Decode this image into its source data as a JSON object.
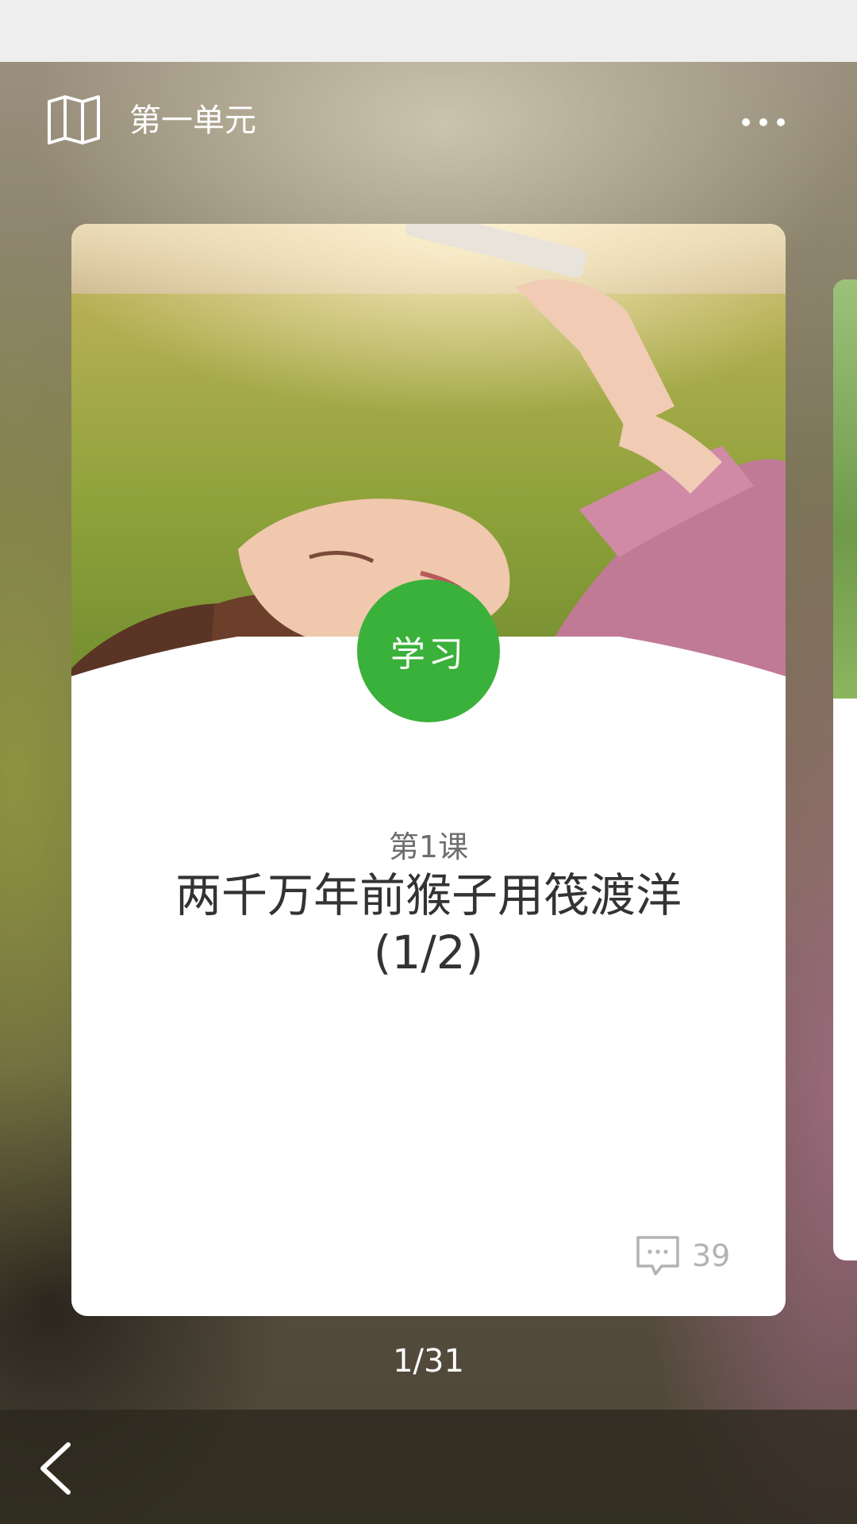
{
  "header": {
    "title": "第一单元",
    "book_icon": "book-open-icon",
    "more_icon": "more-horizontal-icon"
  },
  "card": {
    "badge": "学习",
    "lesson_number": "第1课",
    "lesson_title": "两千万年前猴子用筏渡洋\n(1/2)",
    "comment_icon": "comment-icon",
    "comment_count": "39",
    "badge_color": "#3ab13a"
  },
  "pager": {
    "text": "1/31"
  },
  "footer": {
    "back_icon": "chevron-left-icon"
  }
}
